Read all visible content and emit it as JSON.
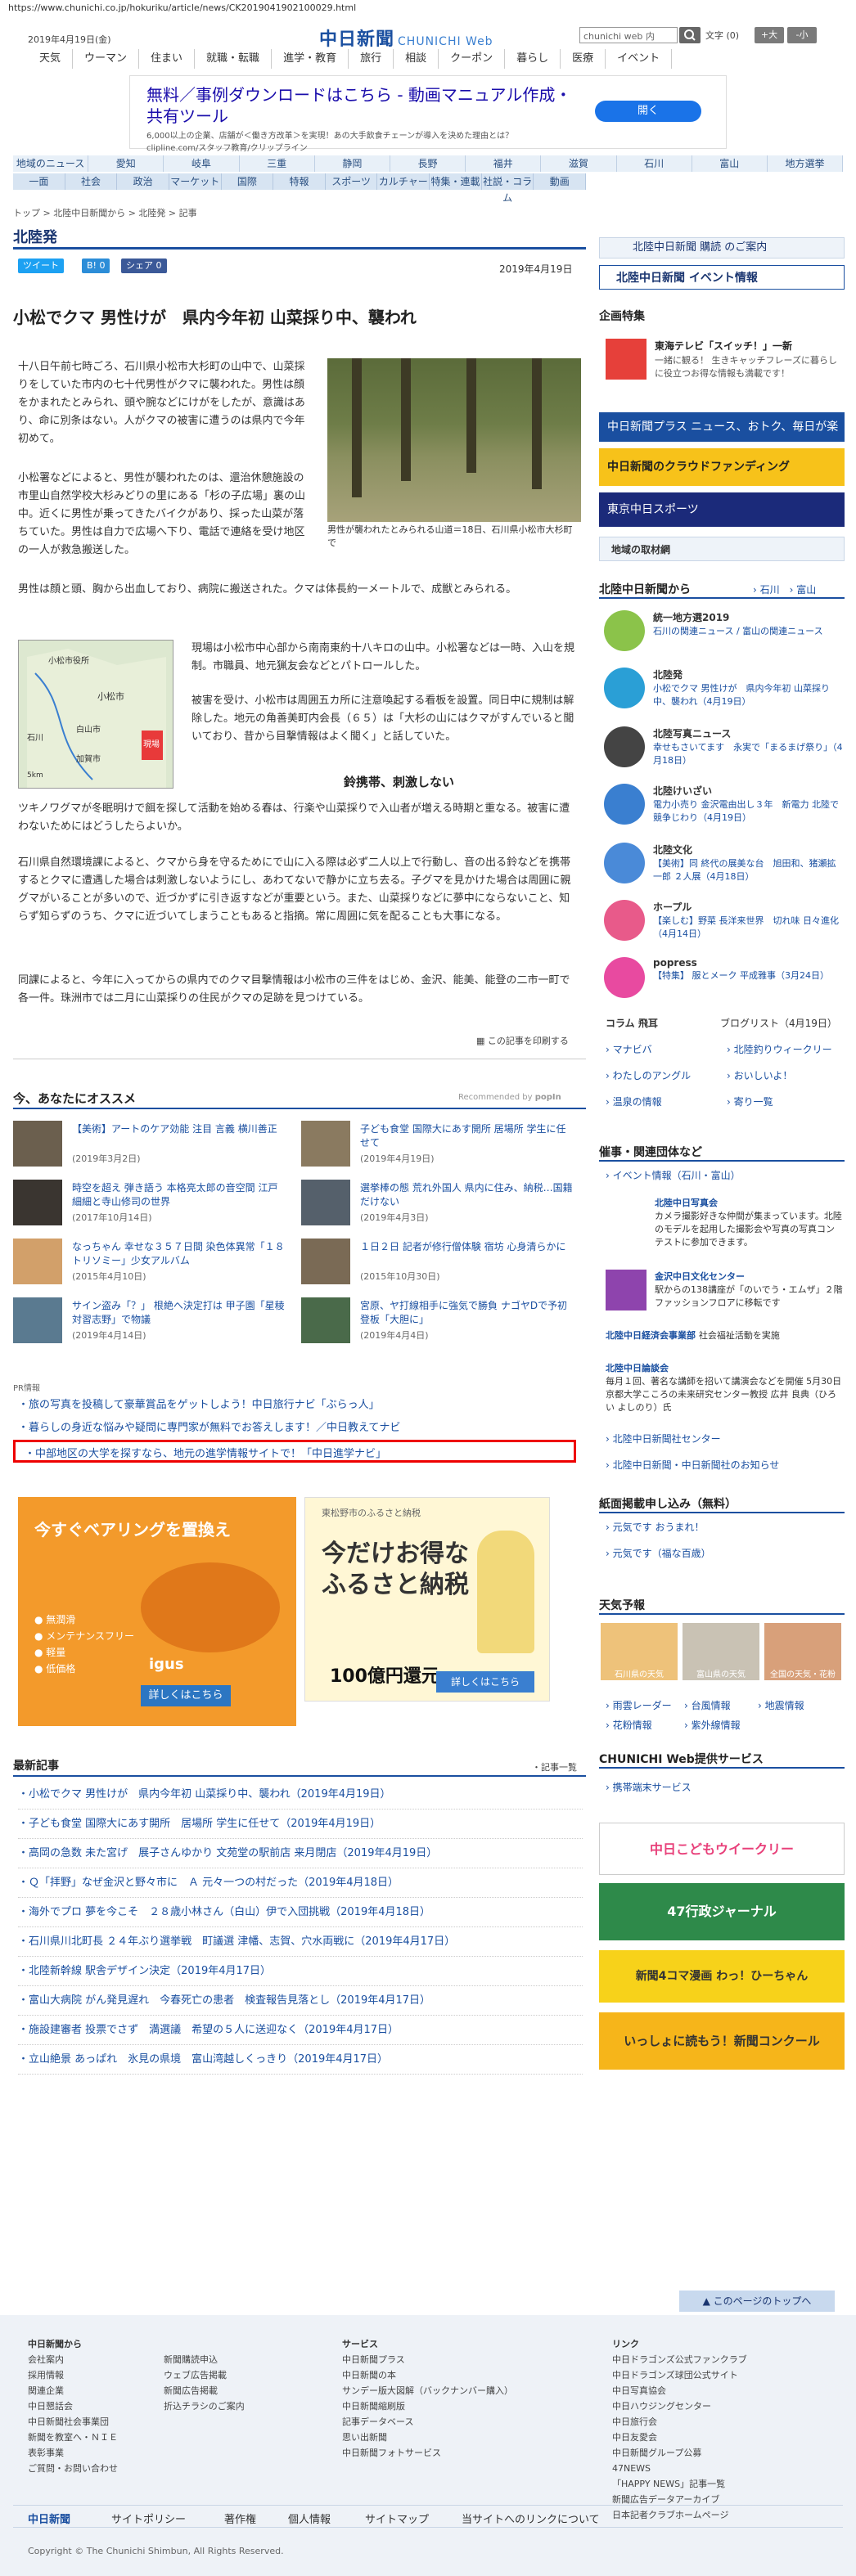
{
  "url": "https://www.chunichi.co.jp/hokuriku/article/news/CK2019041902100029.html",
  "header": {
    "date": "2019年4月19日(金)",
    "logo_main": "中日新聞",
    "logo_sub": "CHUNICHI Web",
    "search_placeholder": "chunichi web 内",
    "font_size_label": "文字 (0)",
    "font_bigger": "+大",
    "font_smaller": "-小",
    "top_nav": [
      "天気",
      "ウーマン",
      "住まい",
      "就職・転職",
      "進学・教育",
      "旅行",
      "相談",
      "クーポン",
      "暮らし",
      "医療",
      "イベント"
    ]
  },
  "ad_top": {
    "title": "無料／事例ダウンロードはこちら - 動画マニュアル作成・共有ツール",
    "sub": "6,000以上の企業、店舗が＜働き方改革＞を実現！あの大手飲食チェーンが導入を決めた理由とは？",
    "domain": "clipline.com/スタッフ教育/クリップライン",
    "button": "開く"
  },
  "nav_regions": [
    "地域のニュース",
    "愛知",
    "岐阜",
    "三重",
    "静岡",
    "長野",
    "福井",
    "滋賀",
    "石川",
    "富山",
    "地方選挙"
  ],
  "nav_topics": [
    "一面",
    "社会",
    "政治",
    "マーケット",
    "国際",
    "特報",
    "スポーツ",
    "カルチャー",
    "特集・連載",
    "社説・コラム",
    "動画"
  ],
  "breadcrumb": "トップ > 北陸中日新聞から > 北陸発 > 記事",
  "section_title": "北陸発",
  "social": {
    "tweet": "ツイート",
    "hatena": "B! 0",
    "share": "シェア 0"
  },
  "article": {
    "date": "2019年4月19日",
    "title": "小松でクマ 男性けが　県内今年初 山菜採り中、襲われ",
    "photo_caption": "男性が襲われたとみられる山道＝18日、石川県小松市大杉町で",
    "p1": "十八日午前七時ごろ、石川県小松市大杉町の山中で、山菜採りをしていた市内の七十代男性がクマに襲われた。男性は顔をかまれたとみられ、頭や腕などにけがをしたが、意識はあり、命に別条はない。人がクマの被害に遭うのは県内で今年初めて。",
    "p2": "小松署などによると、男性が襲われたのは、還治休憩施設の市里山自然学校大杉みどりの里にある「杉の子広場」裏の山中。近くに男性が乗ってきたバイクがあり、採った山菜が落ちていた。男性は自力で広場へ下り、電話で連絡を受け地区の一人が救急搬送した。",
    "p3": "男性は顔と頭、胸から出血しており、病院に搬送された。クマは体長約一メートルで、成獣とみられる。",
    "p4": "現場は小松市中心部から南南東約十八キロの山中。小松署などは一時、入山を規制。市職員、地元猟友会などとパトロールした。",
    "p5": "被害を受け、小松市は周囲五カ所に注意喚起する看板を設置。同日中に規制は解除した。地元の角善美町内会長（６５）は「大杉の山にはクマがすんでいると聞いており、昔から目撃情報はよく聞く」と話していた。",
    "subhead": "鈴携帯、刺激しない",
    "p6": "ツキノワグマが冬眠明けで餌を探して活動を始める春は、行楽や山菜採りで入山者が増える時期と重なる。被害に遭わないためにはどうしたらよいか。",
    "p7": "石川県自然環境課によると、クマから身を守るためにで山に入る際は必ず二人以上で行動し、音の出る鈴などを携帯するとクマに遭遇した場合は刺激しないようにし、あわてないで静かに立ち去る。子グマを見かけた場合は周囲に親グマがいることが多いので、近づかずに引き返すなどが重要という。また、山菜採りなどに夢中にならないこと、知らず知らずのうち、クマに近づいてしまうこともあると指摘。常に周囲に気を配ることも大事になる。",
    "p8": "同課によると、今年に入ってからの県内でのクマ目撃情報は小松市の三件をはじめ、金沢、能美、能登の二市一町で各一件。珠洲市では二月に山菜採りの住民がクマの足跡を見つけている。",
    "map_labels": [
      "小松市役所",
      "小松市",
      "白山市",
      "加賀市",
      "石川",
      "現場"
    ],
    "map_scale": "5km",
    "print": "この記事を印刷する"
  },
  "recommend": {
    "title": "今、あなたにオススメ",
    "provider": "Recommended by",
    "brand": "popIn",
    "items": [
      {
        "title": "【美術】アートのケア効能 注目 言義 横川善正",
        "date": "(2019年3月2日)"
      },
      {
        "title": "子ども食堂 国際大にあす開所 居場所 学生に任せて",
        "date": "(2019年4月19日)"
      },
      {
        "title": "時空を超え 弾き語う 本格亮太郎の音空間 江戸細細と寺山修司の世界",
        "date": "(2017年10月14日)"
      },
      {
        "title": "選挙棒の態 荒れ外国人 県内に住み、納税…国籍だけない",
        "date": "(2019年4月3日)"
      },
      {
        "title": "なっちゃん 幸せな３５７日間 染色体異常「１８トリソミー」少女アルバム",
        "date": "(2015年4月10日)"
      },
      {
        "title": "１日２日 記者が修行僧体験 宿坊 心身清らかに",
        "date": "(2015年10月30日)"
      },
      {
        "title": "サイン盗み「？」 根絶へ決定打は 甲子園「星稜対習志野」で物議",
        "date": "(2019年4月14日)"
      },
      {
        "title": "宮原、ヤ打線相手に強気で勝負 ナゴヤDで予初登板「大胆に」",
        "date": "(2019年4月4日)"
      }
    ]
  },
  "pr": {
    "label": "PR情報",
    "items": [
      "旅の写真を投稿して豪華賞品をゲットしよう！中日旅行ナビ「ぶらっ人」",
      "暮らしの身近な悩みや疑問に専門家が無料でお答えします！／中日教えてナビ",
      "中部地区の大学を探すなら、地元の進学情報サイトで！「中日進学ナビ」"
    ]
  },
  "ad_orange": {
    "title": "今すぐベアリングを置換え",
    "brand": "igus",
    "bullets": [
      "無潤滑",
      "メンテナンスフリー",
      "軽量",
      "低価格"
    ],
    "button": "詳しくはこちら"
  },
  "ad_furusato": {
    "pref": "東松野市のふるさと納税",
    "title": "今だけお得なふるさと納税",
    "price": "100億円還元",
    "button": "詳しくはこちら"
  },
  "latest": {
    "title": "最新記事",
    "more": "記事一覧",
    "items": [
      "小松でクマ 男性けが　県内今年初 山菜採り中、襲われ（2019年4月19日）",
      "子ども食堂 国際大にあす開所　居場所 学生に任せて（2019年4月19日）",
      "高岡の急数 未た宮げ　展子さんゆかり 文苑堂の駅前店 来月閉店（2019年4月19日）",
      "Ｑ「拝野」なぜ金沢と野々市に　Ａ 元々一つの村だった（2019年4月18日）",
      "海外でプロ 夢を今こそ　２８歳小林さん（白山）伊で入団挑戦（2019年4月18日）",
      "石川県川北町長 ２４年ぶり選挙戦　町議選 津幡、志賀、穴水両戦に（2019年4月17日）",
      "北陸新幹線 駅舎デザイン決定（2019年4月17日）",
      "富山大病院 がん発見遅れ　今春死亡の患者　検査報告見落とし（2019年4月17日）",
      "施設建審者 投票でさず　満選議　希望の５人に送迎なく（2019年4月17日）",
      "立山絶景 あっぱれ　氷見の県境　富山湾越しくっきり（2019年4月17日）"
    ]
  },
  "sidebar": {
    "subscribe": "北陸中日新聞 購読 のご案内",
    "events": "北陸中日新聞 イベント情報",
    "kikaku_title": "企画特集",
    "kikaku_item_title": "東海テレビ「スイッチ！」一新",
    "kikaku_item_desc": "一緒に観る！ 生きキャッチフレーズに暮らしに役立つお得な情報も満載です！",
    "banners": [
      "中日新聞プラス ニュース、おトク、毎日が楽しく",
      "中日新聞のクラウドファンディング",
      "東京中日スポーツ"
    ],
    "region_title": "地域の取材網",
    "hokuriku_title": "北陸中日新聞から",
    "hokuriku_links": [
      "石川",
      "富山"
    ],
    "news": [
      {
        "name": "統一地方選2019",
        "desc": "石川の関連ニュース / 富山の関連ニュース"
      },
      {
        "name": "北陸発",
        "desc": "小松でクマ 男性けが　県内今年初 山菜採り中、襲われ（4月19日）"
      },
      {
        "name": "北陸写真ニュース",
        "desc": "幸せもさいてます　永実で「まるまげ祭り」（4月18日）"
      },
      {
        "name": "北陸けいざい",
        "desc": "電力小売り 金沢電由出し３年　新電力 北陸で競争じわり（4月19日）"
      },
      {
        "name": "北陸文化",
        "desc": "【美術】同 終代の展美な台　旭田和、猪瀬拡一郎 ２人展（4月18日）"
      },
      {
        "name": "ホープル",
        "desc": "【楽しむ】野菜 長洋来世界　切れ味 日々進化（4月14日）"
      },
      {
        "name": "popress",
        "desc": "【特集】 服とメーク 平成雅事（3月24日）"
      }
    ],
    "column": "コラム 飛耳",
    "blog": "ブログリスト（4月19日）",
    "links": [
      "マナビバ",
      "北陸釣りウィークリー",
      "わたしのアングル",
      "おいしいよ！",
      "温泉の情報",
      "寄り一覧"
    ],
    "saiji_title": "催事・関連団体など",
    "event_link": "イベント情報（石川・富山）",
    "saiji": [
      {
        "name": "北陸中日写真会",
        "desc": "カメラ撮影好きな仲間が集まっています。北陸のモデルを起用した撮影会や写真の写真コンテストに参加できます。"
      },
      {
        "name": "金沢中日文化センター",
        "desc": "駅からの138講座が「のいでう・エムザ」２階ファッションフロアに移転です"
      },
      {
        "name": "北陸中日経済会事業部",
        "desc": "社会福祉活動を実施"
      },
      {
        "name": "北陸中日論談会",
        "desc": "毎月１回、著名な講師を招いて講演会などを開催 5月30日 京都大学こころの未来研究センター教授 広井 良典（ひろい よしのり）氏"
      }
    ],
    "extra_links": [
      "北陸中日新聞社センター",
      "北陸中日新聞・中日新聞社のお知らせ"
    ],
    "shimen_title": "紙面掲載申し込み（無料）",
    "shimen": [
      "元気です おうまれ！",
      "元気です（福な百歳）"
    ],
    "weather_title": "天気予報",
    "weather": [
      "石川県の天気",
      "富山県の天気",
      "全国の天気・花粉"
    ],
    "weather_links": [
      "雨雲レーダー",
      "台風情報",
      "地震情報",
      "花粉情報",
      "紫外線情報"
    ],
    "service_title": "CHUNICHI Web提供サービス",
    "service_link": "携帯端末サービス",
    "service_banners": [
      "中日こどもウイークリー",
      "47行政ジャーナル",
      "新聞4コマ漫画 わっ！ひーちゃん",
      "いっしょに読もう！新聞コンクール"
    ]
  },
  "footer": {
    "to_top": "このページのトップへ",
    "col1_title": "中日新聞から",
    "col1": [
      "会社案内",
      "採用情報",
      "関連企業",
      "中日懇話会",
      "中日新聞社会事業団",
      "新聞を教室へ・ＮＩＥ",
      "表彰事業",
      "ご質問・お問い合わせ"
    ],
    "col2": [
      "新聞購読申込",
      "ウェブ広告掲載",
      "新聞広告掲載",
      "折込チラシのご案内"
    ],
    "col3_title": "サービス",
    "col3": [
      "中日新聞プラス",
      "中日新聞の本",
      "サンデー版大図解（バックナンバー購入）",
      "中日新聞縮刷版",
      "記事データベース",
      "思い出新聞",
      "中日新聞フォトサービス"
    ],
    "col4_title": "リンク",
    "col4": [
      "中日ドラゴンズ公式ファンクラブ",
      "中日ドラゴンズ球団公式サイト",
      "中日写真協会",
      "中日ハウジングセンター",
      "中日旅行会",
      "中日友愛会",
      "中日新聞グループ公募",
      "47NEWS",
      "「HAPPY NEWS」記事一覧",
      "新聞広告データアーカイブ",
      "日本記者クラブホームページ"
    ],
    "bar_logo": "中日新聞",
    "bar": [
      "サイトポリシー",
      "著作権",
      "個人情報",
      "サイトマップ",
      "当サイトへのリンクについて"
    ],
    "copyright": "Copyright © The Chunichi Shimbun, All Rights Reserved."
  }
}
